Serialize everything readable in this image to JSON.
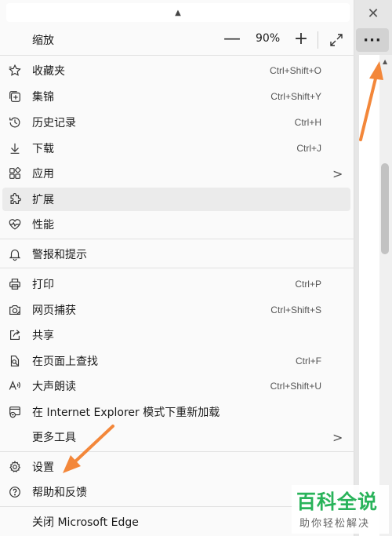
{
  "browser": {
    "close_glyph": "✕",
    "more_glyph": "···"
  },
  "zoom": {
    "label": "缩放",
    "value": "90%",
    "minus": "—",
    "plus": "+",
    "fullscreen_icon": "expand-icon"
  },
  "menu": {
    "items": [
      {
        "label": "收藏夹",
        "shortcut": "Ctrl+Shift+O",
        "icon": "favorites-star-icon"
      },
      {
        "label": "集锦",
        "shortcut": "Ctrl+Shift+Y",
        "icon": "collections-icon"
      },
      {
        "label": "历史记录",
        "shortcut": "Ctrl+H",
        "icon": "history-icon"
      },
      {
        "label": "下载",
        "shortcut": "Ctrl+J",
        "icon": "download-icon"
      },
      {
        "label": "应用",
        "shortcut": "",
        "icon": "apps-icon",
        "submenu": ">"
      },
      {
        "label": "扩展",
        "shortcut": "",
        "icon": "extensions-puzzle-icon"
      },
      {
        "label": "性能",
        "shortcut": "",
        "icon": "performance-heartbeat-icon"
      },
      {
        "label": "警报和提示",
        "shortcut": "",
        "icon": "bell-icon"
      },
      {
        "label": "打印",
        "shortcut": "Ctrl+P",
        "icon": "printer-icon"
      },
      {
        "label": "网页捕获",
        "shortcut": "Ctrl+Shift+S",
        "icon": "web-capture-icon"
      },
      {
        "label": "共享",
        "shortcut": "",
        "icon": "share-icon"
      },
      {
        "label": "在页面上查找",
        "shortcut": "Ctrl+F",
        "icon": "find-on-page-icon"
      },
      {
        "label": "大声朗读",
        "shortcut": "Ctrl+Shift+U",
        "icon": "read-aloud-icon"
      },
      {
        "label": "在 Internet Explorer 模式下重新加载",
        "shortcut": "",
        "icon": "ie-mode-icon"
      },
      {
        "label": "更多工具",
        "shortcut": "",
        "icon": "",
        "submenu": ">"
      },
      {
        "label": "设置",
        "shortcut": "",
        "icon": "gear-icon"
      },
      {
        "label": "帮助和反馈",
        "shortcut": "",
        "icon": "help-question-icon"
      },
      {
        "label": "关闭 Microsoft Edge",
        "shortcut": "",
        "icon": ""
      }
    ]
  },
  "watermark": {
    "title": "百科全说",
    "subtitle": "助你轻松解决"
  },
  "colors": {
    "arrow": "#f3873a",
    "watermark_green": "#29b35a",
    "highlight": "#ebebeb"
  }
}
